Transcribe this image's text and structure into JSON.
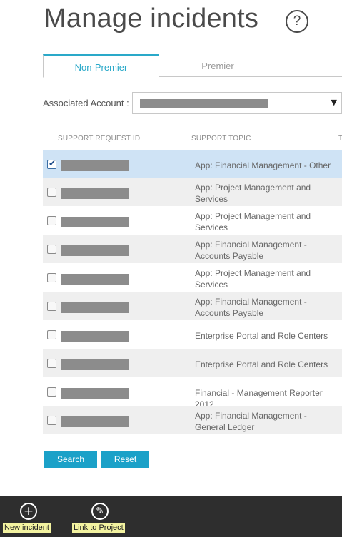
{
  "header": {
    "title": "Manage incidents",
    "help_icon": "question-circle-icon"
  },
  "tabs": [
    {
      "label": "Non-Premier",
      "active": true
    },
    {
      "label": "Premier",
      "active": false
    }
  ],
  "filter": {
    "account_label": "Associated Account :",
    "account_value_redacted": true
  },
  "table": {
    "headers": [
      "SUPPORT REQUEST ID",
      "SUPPORT TOPIC",
      "T"
    ],
    "rows": [
      {
        "checked": true,
        "topic": "App: Financial Management - Other"
      },
      {
        "checked": false,
        "topic": "App: Project Management and Services"
      },
      {
        "checked": false,
        "topic": "App: Project Management and Services"
      },
      {
        "checked": false,
        "topic": "App: Financial Management - Accounts Payable"
      },
      {
        "checked": false,
        "topic": "App: Project Management and Services"
      },
      {
        "checked": false,
        "topic": "App: Financial Management - Accounts Payable"
      },
      {
        "checked": false,
        "topic": "Enterprise Portal and Role Centers"
      },
      {
        "checked": false,
        "topic": "Enterprise Portal and Role Centers"
      },
      {
        "checked": false,
        "topic": "Financial - Management Reporter 2012"
      },
      {
        "checked": false,
        "topic": "App: Financial Management - General Ledger"
      }
    ]
  },
  "buttons": {
    "search": "Search",
    "reset": "Reset"
  },
  "footer": {
    "new_incident": "New incident",
    "new_incident_icon": "plus-circle-icon",
    "link_to_project": "Link to Project",
    "link_to_project_icon": "pencil-circle-icon"
  },
  "colors": {
    "accent": "#1ba1c8",
    "selected_row": "#cfe3f5",
    "footer_bg": "#2e2e2e",
    "footer_label_highlight": "#f3f3a0"
  }
}
